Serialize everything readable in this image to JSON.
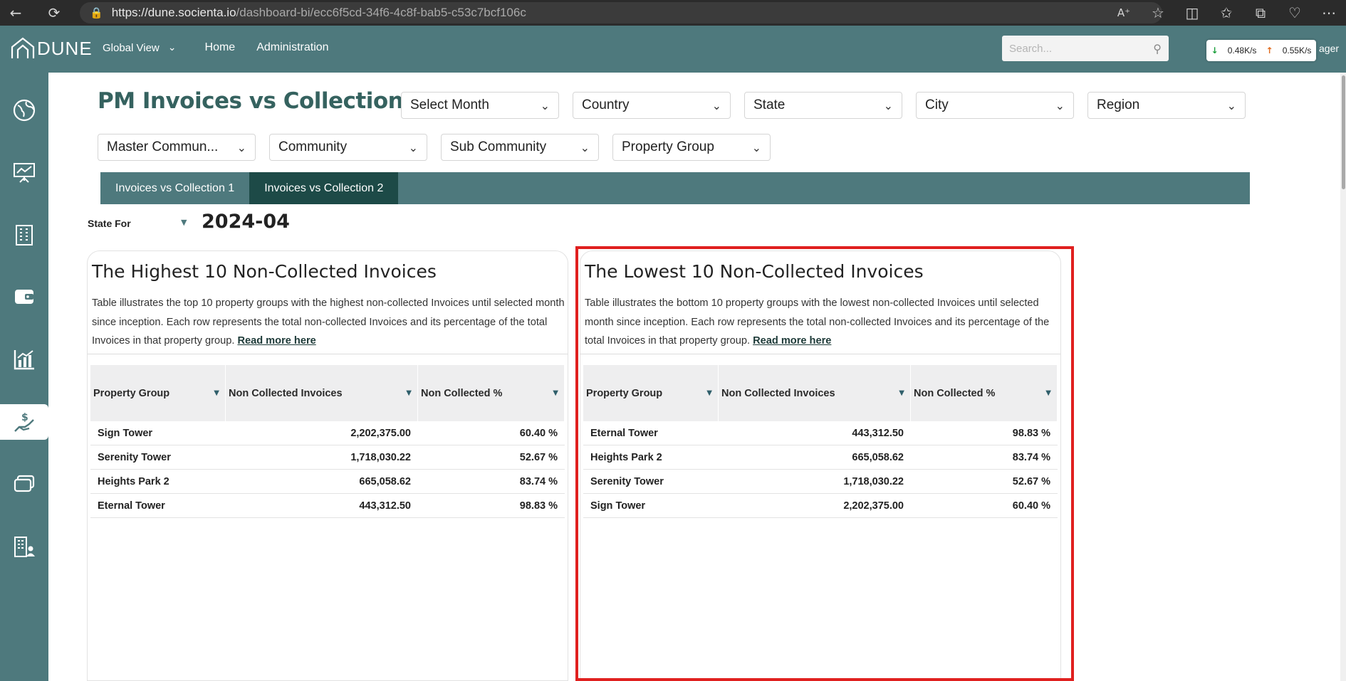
{
  "browser": {
    "url_host": "https://dune.socienta.io",
    "url_path": "/dashboard-bi/ecc6f5cd-34f6-4c8f-bab5-c53c7bcf106c"
  },
  "header": {
    "logo_text": "DUNE",
    "global_view": "Global View",
    "nav": [
      "Home",
      "Administration"
    ],
    "search_placeholder": "Search...",
    "net_down": "0.48K/s",
    "net_up": "0.55K/s",
    "user_partial": "ager"
  },
  "page": {
    "title": "PM Invoices vs Collections"
  },
  "filters": {
    "month": "Select Month",
    "country": "Country",
    "state": "State",
    "city": "City",
    "region": "Region",
    "master_community": "Master Commun...",
    "community": "Community",
    "sub_community": "Sub Community",
    "property_group": "Property Group"
  },
  "tabs": [
    "Invoices vs Collection 1",
    "Invoices vs Collection 2"
  ],
  "state_for": {
    "label": "State For",
    "value": "2024-04"
  },
  "cards": {
    "highest": {
      "title": "The Highest 10 Non-Collected Invoices",
      "desc": "Table illustrates the top 10 property groups with the highest non-collected Invoices until selected month since inception. Each row represents the total non-collected Invoices and its percentage of the total Invoices in that property group.",
      "read_more": "Read more here",
      "columns": [
        "Property Group",
        "Non Collected Invoices",
        "Non Collected %"
      ],
      "rows": [
        {
          "group": "Sign Tower",
          "amount": "2,202,375.00",
          "pct": "60.40 %"
        },
        {
          "group": "Serenity Tower",
          "amount": "1,718,030.22",
          "pct": "52.67 %"
        },
        {
          "group": "Heights Park 2",
          "amount": "665,058.62",
          "pct": "83.74 %"
        },
        {
          "group": "Eternal Tower",
          "amount": "443,312.50",
          "pct": "98.83 %"
        }
      ]
    },
    "lowest": {
      "title": "The Lowest 10 Non-Collected Invoices",
      "desc": "Table illustrates the bottom 10 property groups with the lowest non-collected Invoices until selected month since inception. Each row represents the total non-collected Invoices and its percentage of the total Invoices in that property group.",
      "read_more": "Read more here",
      "columns": [
        "Property Group",
        "Non Collected Invoices",
        "Non Collected %"
      ],
      "rows": [
        {
          "group": "Eternal Tower",
          "amount": "443,312.50",
          "pct": "98.83 %"
        },
        {
          "group": "Heights Park 2",
          "amount": "665,058.62",
          "pct": "83.74 %"
        },
        {
          "group": "Serenity Tower",
          "amount": "1,718,030.22",
          "pct": "52.67 %"
        },
        {
          "group": "Sign Tower",
          "amount": "2,202,375.00",
          "pct": "60.40 %"
        }
      ]
    }
  },
  "colors": {
    "brand": "#4e797d",
    "brand_dark": "#1d4a47",
    "title": "#35625f",
    "highlight": "#e0201f"
  },
  "sidebar_icons": [
    "globe-icon",
    "presentation-icon",
    "building-icon",
    "wallet-icon",
    "chart-icon",
    "payment-hand-icon",
    "stack-icon",
    "building-user-icon"
  ]
}
